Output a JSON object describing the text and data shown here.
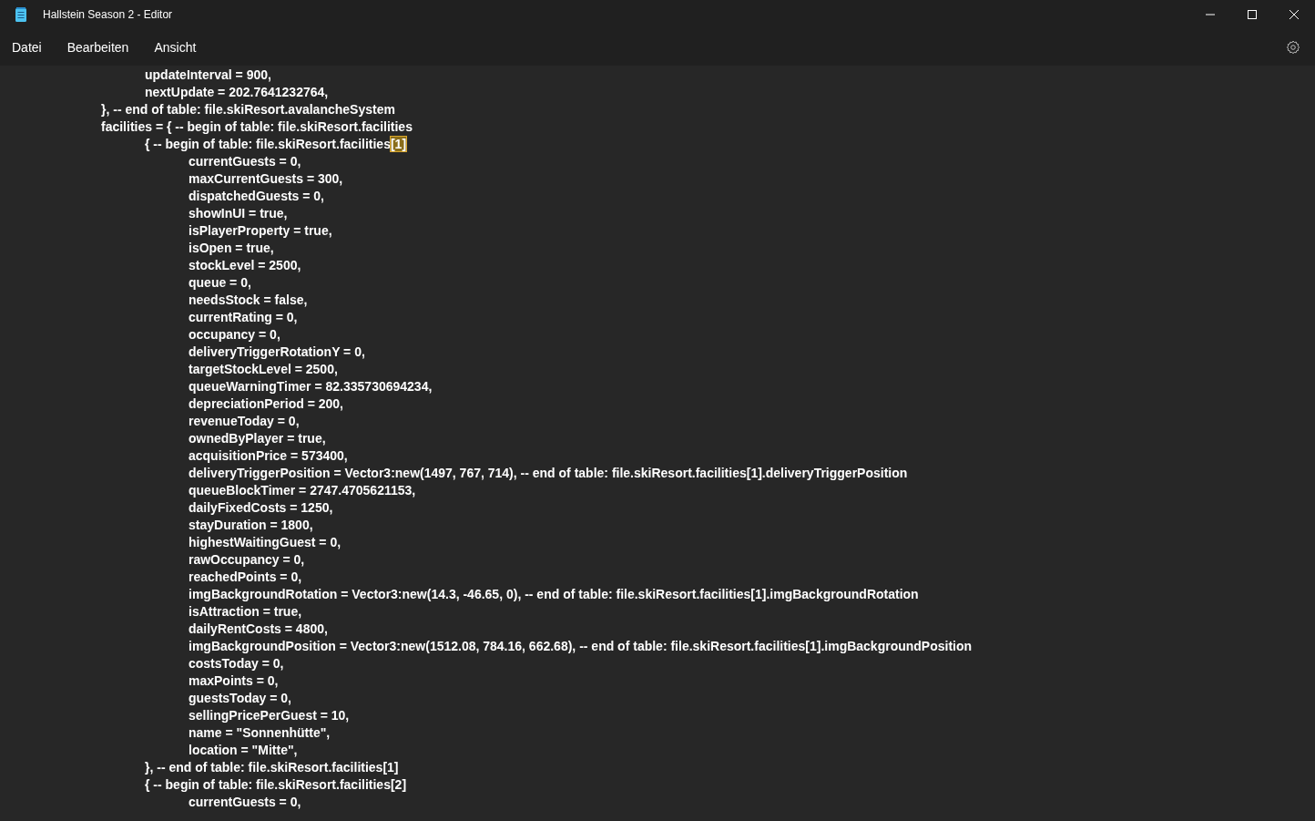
{
  "window": {
    "title": "Hallstein Season 2 - Editor"
  },
  "menu": [
    "Datei",
    "Bearbeiten",
    "Ansicht"
  ],
  "lines": [
    {
      "text": "\t\t\tupdateInterval = 900,"
    },
    {
      "text": "\t\t\tnextUpdate = 202.7641232764,"
    },
    {
      "text": "\t\t}, -- end of table: file.skiResort.avalancheSystem"
    },
    {
      "text": "\t\tfacilities = { -- begin of table: file.skiResort.facilities"
    },
    {
      "text": "\t\t\t{ -- begin of table: file.skiResort.facilities",
      "highlight": "[1]"
    },
    {
      "text": "\t\t\t\tcurrentGuests = 0,"
    },
    {
      "text": "\t\t\t\tmaxCurrentGuests = 300,"
    },
    {
      "text": "\t\t\t\tdispatchedGuests = 0,"
    },
    {
      "text": "\t\t\t\tshowInUI = true,"
    },
    {
      "text": "\t\t\t\tisPlayerProperty = true,"
    },
    {
      "text": "\t\t\t\tisOpen = true,"
    },
    {
      "text": "\t\t\t\tstockLevel = 2500,"
    },
    {
      "text": "\t\t\t\tqueue = 0,"
    },
    {
      "text": "\t\t\t\tneedsStock = false,"
    },
    {
      "text": "\t\t\t\tcurrentRating = 0,"
    },
    {
      "text": "\t\t\t\toccupancy = 0,"
    },
    {
      "text": "\t\t\t\tdeliveryTriggerRotationY = 0,"
    },
    {
      "text": "\t\t\t\ttargetStockLevel = 2500,"
    },
    {
      "text": "\t\t\t\tqueueWarningTimer = 82.335730694234,"
    },
    {
      "text": "\t\t\t\tdepreciationPeriod = 200,"
    },
    {
      "text": "\t\t\t\trevenueToday = 0,"
    },
    {
      "text": "\t\t\t\townedByPlayer = true,"
    },
    {
      "text": "\t\t\t\tacquisitionPrice = 573400,"
    },
    {
      "text": "\t\t\t\tdeliveryTriggerPosition = Vector3:new(1497, 767, 714), -- end of table: file.skiResort.facilities[1].deliveryTriggerPosition"
    },
    {
      "text": "\t\t\t\tqueueBlockTimer = 2747.4705621153,"
    },
    {
      "text": "\t\t\t\tdailyFixedCosts = 1250,"
    },
    {
      "text": "\t\t\t\tstayDuration = 1800,"
    },
    {
      "text": "\t\t\t\thighestWaitingGuest = 0,"
    },
    {
      "text": "\t\t\t\trawOccupancy = 0,"
    },
    {
      "text": "\t\t\t\treachedPoints = 0,"
    },
    {
      "text": "\t\t\t\timgBackgroundRotation = Vector3:new(14.3, -46.65, 0), -- end of table: file.skiResort.facilities[1].imgBackgroundRotation"
    },
    {
      "text": "\t\t\t\tisAttraction = true,"
    },
    {
      "text": "\t\t\t\tdailyRentCosts = 4800,"
    },
    {
      "text": "\t\t\t\timgBackgroundPosition = Vector3:new(1512.08, 784.16, 662.68), -- end of table: file.skiResort.facilities[1].imgBackgroundPosition"
    },
    {
      "text": "\t\t\t\tcostsToday = 0,"
    },
    {
      "text": "\t\t\t\tmaxPoints = 0,"
    },
    {
      "text": "\t\t\t\tguestsToday = 0,"
    },
    {
      "text": "\t\t\t\tsellingPricePerGuest = 10,"
    },
    {
      "text": "\t\t\t\tname = \"Sonnenhütte\","
    },
    {
      "text": "\t\t\t\tlocation = \"Mitte\","
    },
    {
      "text": "\t\t\t}, -- end of table: file.skiResort.facilities[1]"
    },
    {
      "text": "\t\t\t{ -- begin of table: file.skiResort.facilities[2]"
    },
    {
      "text": "\t\t\t\tcurrentGuests = 0,"
    }
  ]
}
